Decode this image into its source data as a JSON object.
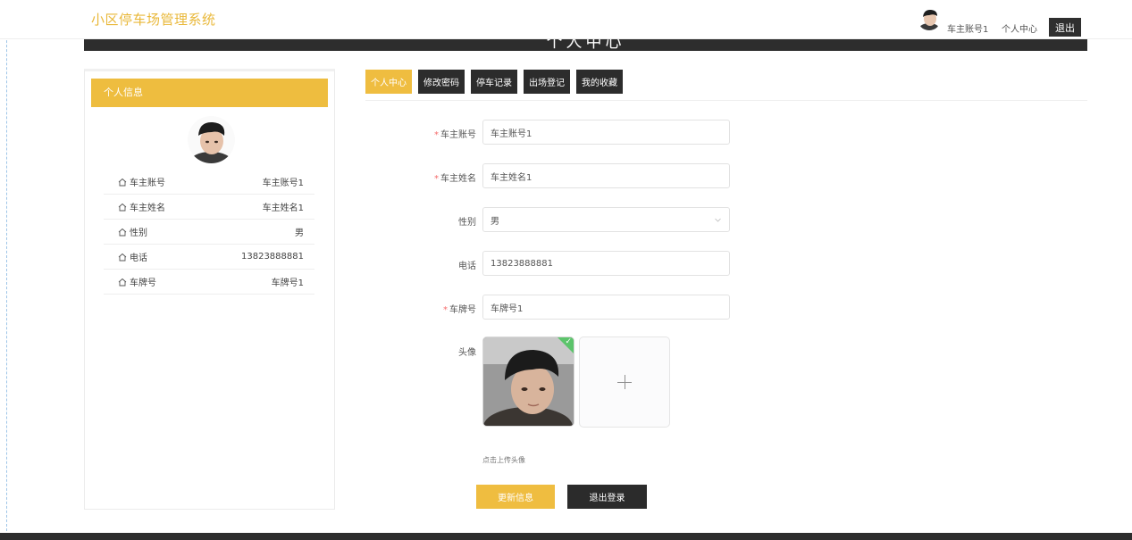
{
  "header": {
    "site_title": "小区停车场管理系统",
    "account": "车主账号1",
    "center_link": "个人中心",
    "logout": "退出"
  },
  "banner": {
    "title": "个人中心"
  },
  "card": {
    "title": "个人信息",
    "rows": [
      {
        "key": "车主账号",
        "value": "车主账号1"
      },
      {
        "key": "车主姓名",
        "value": "车主姓名1"
      },
      {
        "key": "性别",
        "value": "男"
      },
      {
        "key": "电话",
        "value": "13823888881"
      },
      {
        "key": "车牌号",
        "value": "车牌号1"
      }
    ]
  },
  "tabs": [
    {
      "label": "个人中心",
      "active": true
    },
    {
      "label": "修改密码",
      "active": false
    },
    {
      "label": "停车记录",
      "active": false
    },
    {
      "label": "出场登记",
      "active": false
    },
    {
      "label": "我的收藏",
      "active": false
    }
  ],
  "form": {
    "account_label": "车主账号",
    "account_value": "车主账号1",
    "name_label": "车主姓名",
    "name_value": "车主姓名1",
    "gender_label": "性别",
    "gender_value": "男",
    "phone_label": "电话",
    "phone_value": "13823888881",
    "plate_label": "车牌号",
    "plate_value": "车牌号1",
    "avatar_label": "头像",
    "upload_hint": "点击上传头像",
    "update_button": "更新信息",
    "logout_button": "退出登录"
  },
  "colors": {
    "accent": "#efbd40",
    "dark": "#2c2c2c",
    "required": "#f56c6c",
    "success": "#5cc46b"
  }
}
